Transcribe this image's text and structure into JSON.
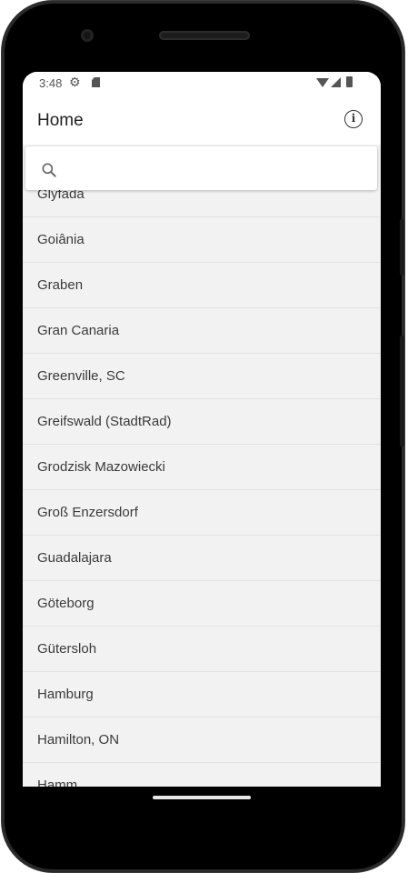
{
  "status": {
    "time": "3:48",
    "icons": [
      "gear-icon",
      "sd-card-icon",
      "wifi-icon",
      "signal-icon",
      "battery-icon"
    ]
  },
  "appbar": {
    "title": "Home",
    "info_icon": "info-icon",
    "info_glyph": "i"
  },
  "search": {
    "placeholder": "",
    "value": "",
    "icon": "search-icon"
  },
  "cities": [
    "Glyfada",
    "Goiânia",
    "Graben",
    "Gran Canaria",
    "Greenville, SC",
    "Greifswald (StadtRad)",
    "Grodzisk Mazowiecki",
    "Groß Enzersdorf",
    "Guadalajara",
    "Göteborg",
    "Gütersloh",
    "Hamburg",
    "Hamilton, ON",
    "Hamm"
  ],
  "colors": {
    "list_background": "#f2f2f2",
    "appbar_background": "#ffffff",
    "text": "#3a3a3a"
  }
}
